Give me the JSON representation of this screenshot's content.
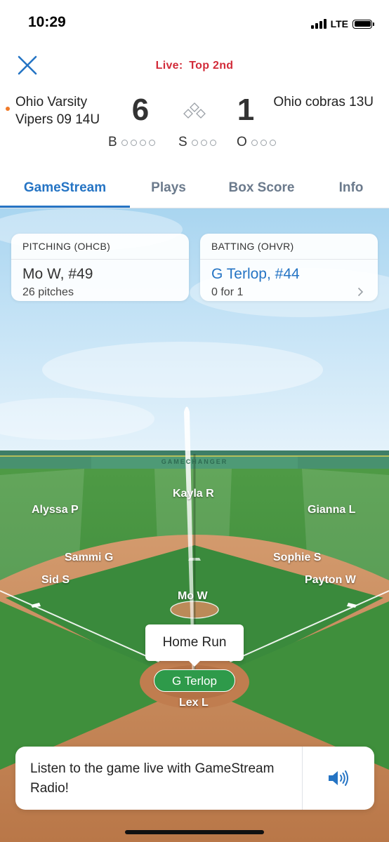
{
  "status_bar": {
    "time": "10:29",
    "network": "LTE"
  },
  "header": {
    "live_label": "Live:",
    "inning": "Top 2nd",
    "away_team": "Ohio Varsity Vipers 09 14U",
    "away_score": "6",
    "home_team": "Ohio cobras 13U",
    "home_score": "1",
    "count": {
      "balls_label": "B",
      "strikes_label": "S",
      "outs_label": "O",
      "balls": 0,
      "strikes": 0,
      "outs": 0
    }
  },
  "tabs": [
    {
      "label": "GameStream",
      "active": true
    },
    {
      "label": "Plays",
      "active": false
    },
    {
      "label": "Box Score",
      "active": false
    },
    {
      "label": "Info",
      "active": false
    }
  ],
  "pitching_card": {
    "title": "PITCHING (OHCB)",
    "name": "Mo W, #49",
    "sub": "26 pitches"
  },
  "batting_card": {
    "title": "BATTING (OHVR)",
    "name": "G Terlop, #44",
    "sub": "0 for 1"
  },
  "field": {
    "wall_text": "GAMECHANGER",
    "players": {
      "cf": "Kayla R",
      "lf": "Alyssa P",
      "rf": "Gianna L",
      "ss": "Sammi G",
      "second": "Sophie S",
      "third": "Sid S",
      "first": "Payton W",
      "pitcher": "Mo W",
      "catcher": "Lex L"
    },
    "batter": "G Terlop",
    "play_result": "Home Run"
  },
  "radio": {
    "text": "Listen to the game live with GameStream Radio!"
  },
  "colors": {
    "accent": "#2574c4",
    "live": "#d22c3a",
    "grass": "#3f8f3c",
    "dirt": "#c98a5c"
  }
}
